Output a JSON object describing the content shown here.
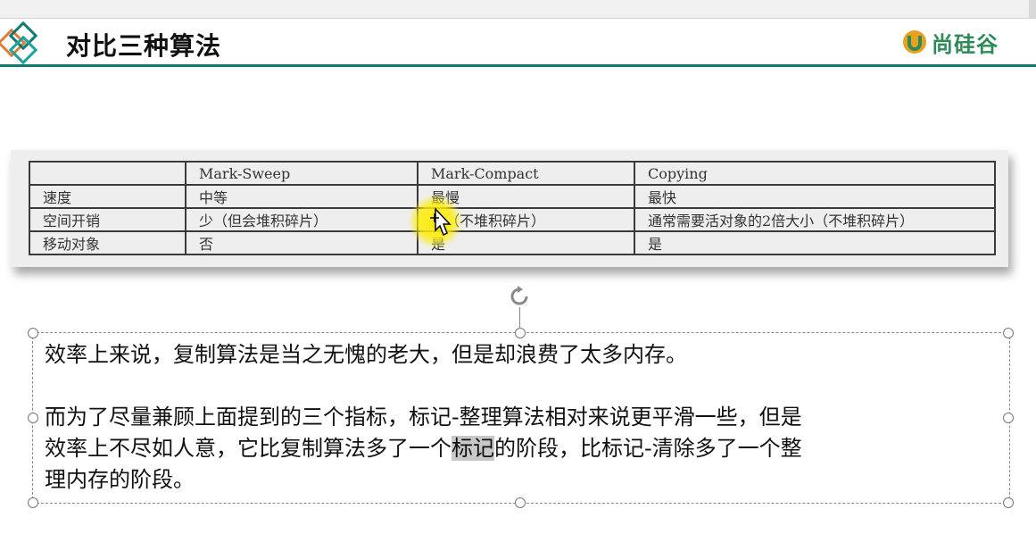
{
  "slide": {
    "title": "对比三种算法",
    "logo_text": "尚硅谷",
    "brand_color": "#137a72",
    "logo_color": "#2e8b57"
  },
  "table": {
    "headers": [
      "",
      "Mark-Sweep",
      "Mark-Compact",
      "Copying"
    ],
    "rows": [
      [
        "速度",
        "中等",
        "最慢",
        "最快"
      ],
      [
        "空间开销",
        "少（但会堆积碎片）",
        "少（不堆积碎片）",
        "通常需要活对象的2倍大小（不堆积碎片）"
      ],
      [
        "移动对象",
        "否",
        "是",
        "是"
      ]
    ]
  },
  "textbox": {
    "para1": "效率上来说，复制算法是当之无愧的老大，但是却浪费了太多内存。",
    "para2_line1": "而为了尽量兼顾上面提到的三个指标，标记-整理算法相对来说更平滑一些，但是",
    "para2_line2_before": "效率上不尽如人意，它比复制算法多了一个",
    "para2_line2_highlight": "标记",
    "para2_line2_after": "的阶段，比标记-清除多了一个整",
    "para2_line3": "理内存的阶段。",
    "highlight_color": "#c8c8c8"
  },
  "icons": {
    "header": "diamonds-logo-icon",
    "brand": "shangguigu-logo-icon",
    "rotate": "rotate-handle-icon",
    "pointer": "move-cursor-icon"
  }
}
